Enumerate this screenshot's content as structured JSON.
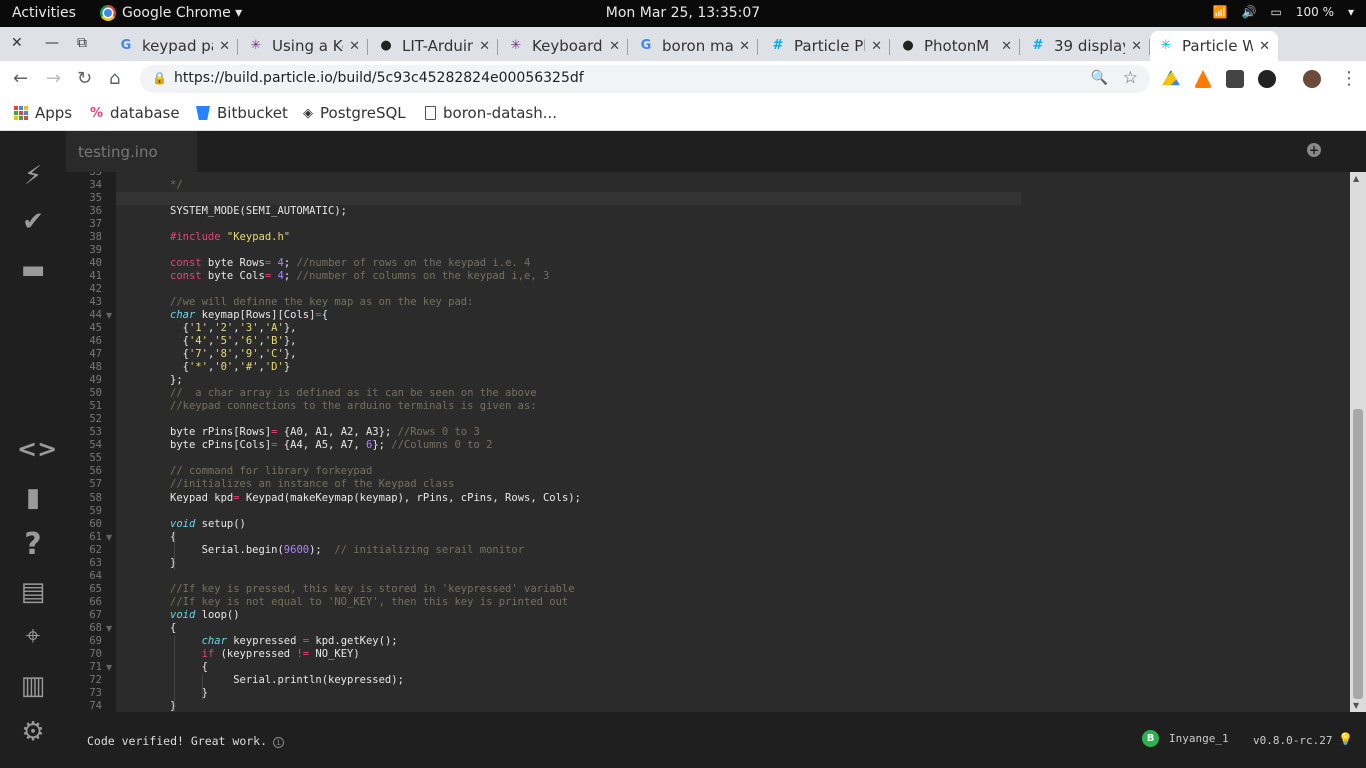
{
  "topbar": {
    "activities": "Activities",
    "app_name": "Google Chrome ▾",
    "clock": "Mon Mar 25, 13:35:07",
    "battery": "100 %"
  },
  "tabs": [
    {
      "title": "keypad pa",
      "favicon": "google-icon",
      "color": "#4285f4"
    },
    {
      "title": "Using a Ke",
      "favicon": "particle-star-icon",
      "color": "#7b2d8e"
    },
    {
      "title": "LIT-Arduin",
      "favicon": "github-icon",
      "color": "#222222"
    },
    {
      "title": "Keyboard",
      "favicon": "particle-star-icon",
      "color": "#7b2d8e"
    },
    {
      "title": "boron ma",
      "favicon": "google-icon",
      "color": "#4285f4"
    },
    {
      "title": "Particle Pl",
      "favicon": "particle-hash-icon",
      "color": "#00aeef"
    },
    {
      "title": "PhotonM",
      "favicon": "github-icon",
      "color": "#222222"
    },
    {
      "title": "39 display",
      "favicon": "particle-hash-icon",
      "color": "#00aeef"
    },
    {
      "title": "Particle W",
      "favicon": "particle-star-icon",
      "color": "#00aeef"
    }
  ],
  "navbar": {
    "url": "https://build.particle.io/build/5c93c45282824e00056325df"
  },
  "bookmarks": [
    {
      "label": "Apps",
      "icon": "apps-grid-icon"
    },
    {
      "label": "database",
      "icon": "database-icon"
    },
    {
      "label": "Bitbucket",
      "icon": "bitbucket-icon"
    },
    {
      "label": "PostgreSQL",
      "icon": "postgresql-icon"
    },
    {
      "label": "boron-datash...",
      "icon": "page-icon"
    }
  ],
  "ide": {
    "file_tab": "testing.ino",
    "status_message": "Code verified! Great work.",
    "device_badge": "B",
    "device_name": "Inyange_1",
    "firmware_version": "v0.8.0-rc.27",
    "sidebar_icons": [
      "flash-icon",
      "verify-icon",
      "folder-icon",
      "code-icon",
      "bookmark-icon",
      "help-icon",
      "docs-icon",
      "target-icon",
      "stats-icon",
      "settings-icon"
    ]
  },
  "colors": {
    "keyword": "#e8417a",
    "type": "#66d9ef",
    "number": "#ae81ff",
    "string": "#e6db74",
    "comment": "#75715e",
    "text": "#e8e8e8"
  },
  "code": {
    "line_numbers": [
      "33",
      "34",
      "35",
      "36",
      "37",
      "38",
      "39",
      "40",
      "41",
      "42",
      "43",
      "44",
      "45",
      "46",
      "47",
      "48",
      "49",
      "50",
      "51",
      "52",
      "53",
      "54",
      "55",
      "56",
      "57",
      "58",
      "59",
      "60",
      "61",
      "62",
      "63",
      "64",
      "65",
      "66",
      "67",
      "68",
      "69",
      "70",
      "71",
      "72",
      "73",
      "74"
    ],
    "lines": [
      [],
      [
        {
          "t": "*/",
          "c": "comment"
        }
      ],
      [],
      [
        {
          "t": "SYSTEM_MODE(SEMI_AUTOMATIC);",
          "c": "text"
        }
      ],
      [],
      [
        {
          "t": "#include ",
          "c": "keyword"
        },
        {
          "t": "\"Keypad.h\"",
          "c": "string"
        }
      ],
      [],
      [
        {
          "t": "const",
          "c": "keyword"
        },
        {
          "t": " byte Rows",
          "c": "text"
        },
        {
          "t": "=",
          "c": "keyword"
        },
        {
          "t": " ",
          "c": "text"
        },
        {
          "t": "4",
          "c": "number"
        },
        {
          "t": "; ",
          "c": "text"
        },
        {
          "t": "//number of rows on the keypad i.e. 4",
          "c": "comment"
        }
      ],
      [
        {
          "t": "const",
          "c": "keyword"
        },
        {
          "t": " byte Cols",
          "c": "text"
        },
        {
          "t": "=",
          "c": "keyword"
        },
        {
          "t": " ",
          "c": "text"
        },
        {
          "t": "4",
          "c": "number"
        },
        {
          "t": "; ",
          "c": "text"
        },
        {
          "t": "//number of columns on the keypad i,e, 3",
          "c": "comment"
        }
      ],
      [],
      [
        {
          "t": "//we will definne the key map as on the key pad:",
          "c": "comment"
        }
      ],
      [
        {
          "t": "char",
          "c": "type"
        },
        {
          "t": " keymap[Rows][Cols]",
          "c": "text"
        },
        {
          "t": "=",
          "c": "keyword"
        },
        {
          "t": "{",
          "c": "text"
        }
      ],
      [
        {
          "t": "  {",
          "c": "text"
        },
        {
          "t": "'1'",
          "c": "string"
        },
        {
          "t": ",",
          "c": "text"
        },
        {
          "t": "'2'",
          "c": "string"
        },
        {
          "t": ",",
          "c": "text"
        },
        {
          "t": "'3'",
          "c": "string"
        },
        {
          "t": ",",
          "c": "text"
        },
        {
          "t": "'A'",
          "c": "string"
        },
        {
          "t": "},",
          "c": "text"
        }
      ],
      [
        {
          "t": "  {",
          "c": "text"
        },
        {
          "t": "'4'",
          "c": "string"
        },
        {
          "t": ",",
          "c": "text"
        },
        {
          "t": "'5'",
          "c": "string"
        },
        {
          "t": ",",
          "c": "text"
        },
        {
          "t": "'6'",
          "c": "string"
        },
        {
          "t": ",",
          "c": "text"
        },
        {
          "t": "'B'",
          "c": "string"
        },
        {
          "t": "},",
          "c": "text"
        }
      ],
      [
        {
          "t": "  {",
          "c": "text"
        },
        {
          "t": "'7'",
          "c": "string"
        },
        {
          "t": ",",
          "c": "text"
        },
        {
          "t": "'8'",
          "c": "string"
        },
        {
          "t": ",",
          "c": "text"
        },
        {
          "t": "'9'",
          "c": "string"
        },
        {
          "t": ",",
          "c": "text"
        },
        {
          "t": "'C'",
          "c": "string"
        },
        {
          "t": "},",
          "c": "text"
        }
      ],
      [
        {
          "t": "  {",
          "c": "text"
        },
        {
          "t": "'*'",
          "c": "string"
        },
        {
          "t": ",",
          "c": "text"
        },
        {
          "t": "'0'",
          "c": "string"
        },
        {
          "t": ",",
          "c": "text"
        },
        {
          "t": "'#'",
          "c": "string"
        },
        {
          "t": ",",
          "c": "text"
        },
        {
          "t": "'D'",
          "c": "string"
        },
        {
          "t": "}",
          "c": "text"
        }
      ],
      [
        {
          "t": "};",
          "c": "text"
        }
      ],
      [
        {
          "t": "//  a char array is defined as it can be seen on the above",
          "c": "comment"
        }
      ],
      [
        {
          "t": "//keypad connections to the arduino terminals is given as:",
          "c": "comment"
        }
      ],
      [],
      [
        {
          "t": "byte rPins[Rows]",
          "c": "text"
        },
        {
          "t": "=",
          "c": "keyword"
        },
        {
          "t": " {A0, A1, A2, A3}; ",
          "c": "text"
        },
        {
          "t": "//Rows 0 to 3",
          "c": "comment"
        }
      ],
      [
        {
          "t": "byte cPins[Cols]",
          "c": "text"
        },
        {
          "t": "=",
          "c": "keyword"
        },
        {
          "t": " {A4, A5, A7, ",
          "c": "text"
        },
        {
          "t": "6",
          "c": "number"
        },
        {
          "t": "}; ",
          "c": "text"
        },
        {
          "t": "//Columns 0 to 2",
          "c": "comment"
        }
      ],
      [],
      [
        {
          "t": "// command for library forkeypad",
          "c": "comment"
        }
      ],
      [
        {
          "t": "//initializes an instance of the Keypad class",
          "c": "comment"
        }
      ],
      [
        {
          "t": "Keypad kpd",
          "c": "text"
        },
        {
          "t": "=",
          "c": "keyword"
        },
        {
          "t": " Keypad(makeKeymap(keymap), rPins, cPins, Rows, Cols);",
          "c": "text"
        }
      ],
      [],
      [
        {
          "t": "void",
          "c": "type"
        },
        {
          "t": " setup()",
          "c": "text"
        }
      ],
      [
        {
          "t": "{",
          "c": "text"
        }
      ],
      [
        {
          "t": "     Serial.begin(",
          "c": "text"
        },
        {
          "t": "9600",
          "c": "number"
        },
        {
          "t": ");  ",
          "c": "text"
        },
        {
          "t": "// initializing serail monitor",
          "c": "comment"
        }
      ],
      [
        {
          "t": "}",
          "c": "text"
        }
      ],
      [],
      [
        {
          "t": "//If key is pressed, this key is stored in 'keypressed' variable",
          "c": "comment"
        }
      ],
      [
        {
          "t": "//If key is not equal to 'NO_KEY', then this key is printed out",
          "c": "comment"
        }
      ],
      [
        {
          "t": "void",
          "c": "type"
        },
        {
          "t": " loop()",
          "c": "text"
        }
      ],
      [
        {
          "t": "{",
          "c": "text"
        }
      ],
      [
        {
          "t": "     ",
          "c": "text"
        },
        {
          "t": "char",
          "c": "type"
        },
        {
          "t": " keypressed ",
          "c": "text"
        },
        {
          "t": "=",
          "c": "keyword"
        },
        {
          "t": " kpd.getKey();",
          "c": "text"
        }
      ],
      [
        {
          "t": "     ",
          "c": "text"
        },
        {
          "t": "if",
          "c": "keyword"
        },
        {
          "t": " (keypressed ",
          "c": "text"
        },
        {
          "t": "!=",
          "c": "keyword"
        },
        {
          "t": " NO_KEY)",
          "c": "text"
        }
      ],
      [
        {
          "t": "     {",
          "c": "text"
        }
      ],
      [
        {
          "t": "          Serial.println(keypressed);",
          "c": "text"
        }
      ],
      [
        {
          "t": "     }",
          "c": "text"
        }
      ],
      [
        {
          "t": "}",
          "c": "text"
        }
      ]
    ],
    "fold_lines": [
      "44",
      "61",
      "68",
      "71"
    ]
  }
}
